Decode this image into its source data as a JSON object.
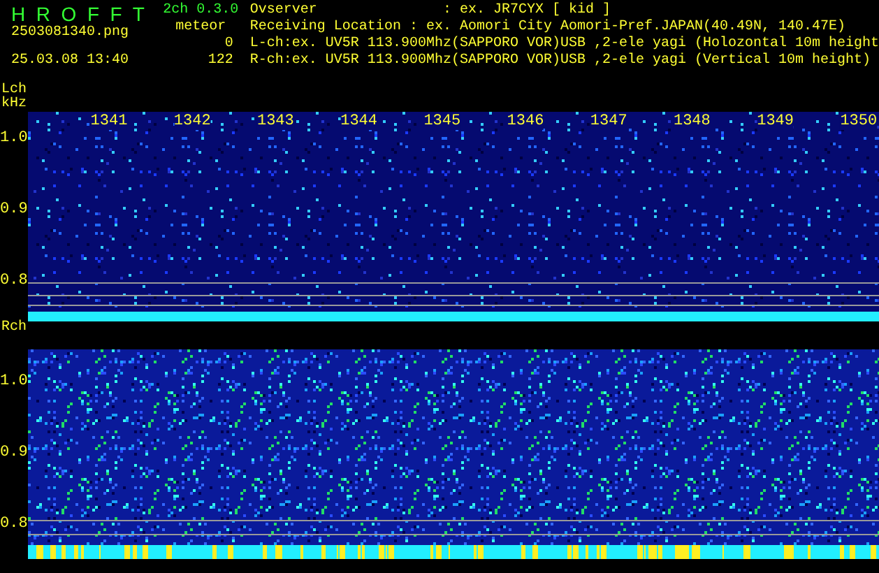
{
  "header": {
    "app_title": "H R O F F T",
    "version": "2ch 0.3.0",
    "file_name": "2503081340.png",
    "timestamp": "25.03.08 13:40",
    "meteor_label": "meteor",
    "meteor_counts": [
      "0",
      "122"
    ],
    "info_lines": [
      "Ovserver               : ex. JR7CYX [ kid ]",
      "Receiving Location : ex. Aomori City Aomori-Pref.JAPAN(40.49N, 140.47E)",
      "L-ch:ex. UV5R 113.900Mhz(SAPPORO VOR)USB ,2-ele yagi (Holozontal 10m height",
      "R-ch:ex. UV5R 113.900Mhz(SAPPORO VOR)USB ,2-ele yagi (Vertical 10m height)"
    ]
  },
  "panels": [
    {
      "label": "Lch",
      "unit": "kHz",
      "time_labels": [
        "1341",
        "1342",
        "1343",
        "1344",
        "1345",
        "1346",
        "1347",
        "1348",
        "1349",
        "1350"
      ],
      "freq_labels": [
        "1.0",
        "0.9",
        "0.8"
      ]
    },
    {
      "label": "Rch",
      "freq_labels": [
        "1.0",
        "0.9",
        "0.8"
      ]
    }
  ]
}
